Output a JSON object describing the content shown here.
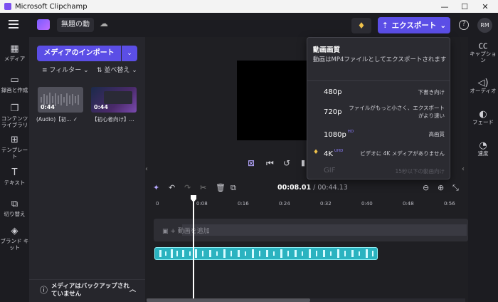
{
  "window": {
    "title": "Microsoft Clipchamp",
    "minimize": "—",
    "maximize": "☐",
    "close": "✕"
  },
  "topbar": {
    "project_name": "無題の動",
    "export_label": "エクスポート",
    "export_icon": "⇡",
    "chevron": "⌄",
    "gem_icon": "♦",
    "help_icon": "?",
    "avatar": "RM"
  },
  "left_rail": [
    {
      "icon": "▦",
      "label": "メディア"
    },
    {
      "icon": "▭",
      "label": "録画と作成"
    },
    {
      "icon": "❐",
      "label": "コンテンツライブラリ"
    },
    {
      "icon": "⊞",
      "label": "テンプレート"
    },
    {
      "icon": "T",
      "label": "テキスト"
    },
    {
      "icon": "⧉",
      "label": "切り替え"
    },
    {
      "icon": "◈",
      "label": "ブランド キット"
    }
  ],
  "media_panel": {
    "import_label": "メディアのインポート",
    "filter_label": "フィルター",
    "sort_label": "並べ替え",
    "items": [
      {
        "duration": "0:44",
        "caption": "(Audio)【初...",
        "check": "✓"
      },
      {
        "duration": "0:44",
        "caption": "【初心者向け】..."
      }
    ],
    "backup_notice": "メディアはバックアップされていません",
    "backup_icon": "ⓘ",
    "backup_chevron": "︿"
  },
  "right_rail": [
    {
      "icon": "㏄",
      "label": "キャプション"
    },
    {
      "icon": "◁)",
      "label": "オーディオ"
    },
    {
      "icon": "◐",
      "label": "フェード"
    },
    {
      "icon": "◔",
      "label": "速度"
    }
  ],
  "export_popup": {
    "title": "動画画質",
    "description": "動画はMP4ファイルとしてエクスポートされます",
    "options": [
      {
        "label": "480p",
        "badge": "",
        "desc": "下書き向け",
        "disabled": false
      },
      {
        "label": "720p",
        "badge": "",
        "desc": "ファイルがもっと小さく、エクスポートがより速い",
        "disabled": false
      },
      {
        "label": "1080p",
        "badge": "HD",
        "desc": "高画質",
        "disabled": false
      },
      {
        "label": "4K",
        "badge": "UHD",
        "desc": "ビデオに 4K メディアがありません",
        "disabled": false,
        "premium": true
      },
      {
        "label": "GIF",
        "badge": "",
        "desc": "15秒以下の動画向け",
        "disabled": true
      }
    ]
  },
  "timeline": {
    "current": "00:08.01",
    "separator": " / ",
    "total": "00:44.13",
    "add_media_label": "動画を追加",
    "ruler_ticks": [
      "0",
      "0:08",
      "0:16",
      "0:24",
      "0:32",
      "0:40",
      "0:48",
      "0:56"
    ]
  }
}
